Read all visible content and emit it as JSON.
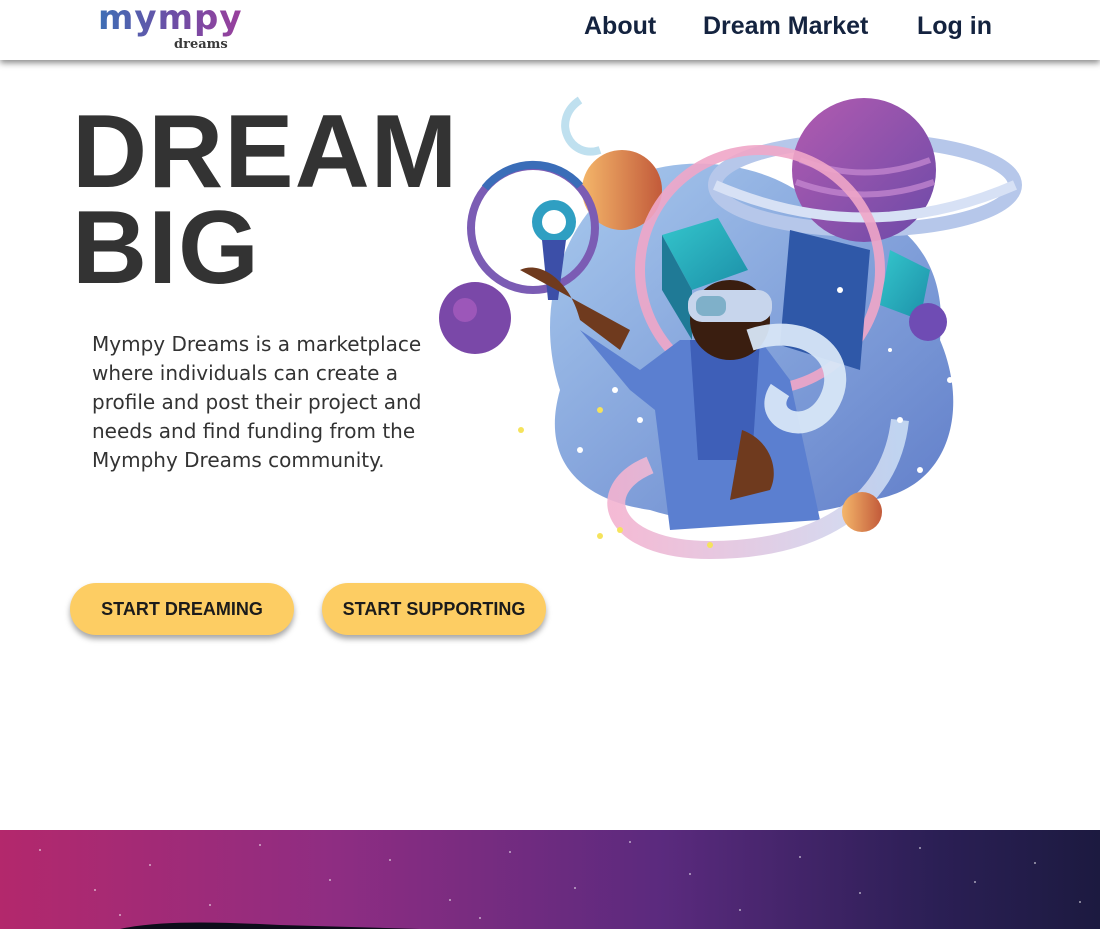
{
  "header": {
    "logo": {
      "main": "mympy",
      "sub": "dreams"
    },
    "nav": [
      {
        "label": "About"
      },
      {
        "label": "Dream Market"
      },
      {
        "label": "Log in"
      }
    ]
  },
  "hero": {
    "title_line1": "DREAM",
    "title_line2": "BIG",
    "description": "Mympy Dreams is a marketplace where individuals can create a profile and post their project and needs and find funding from the Mymphy Dreams community.",
    "buttons": {
      "start_dreaming": "START DREAMING",
      "start_supporting": "START SUPPORTING"
    }
  },
  "colors": {
    "nav_text": "#14233f",
    "title_text": "#333333",
    "button_bg": "#fdcd63",
    "footer_gradient_start": "#b3286c",
    "footer_gradient_end": "#1c1a40"
  }
}
